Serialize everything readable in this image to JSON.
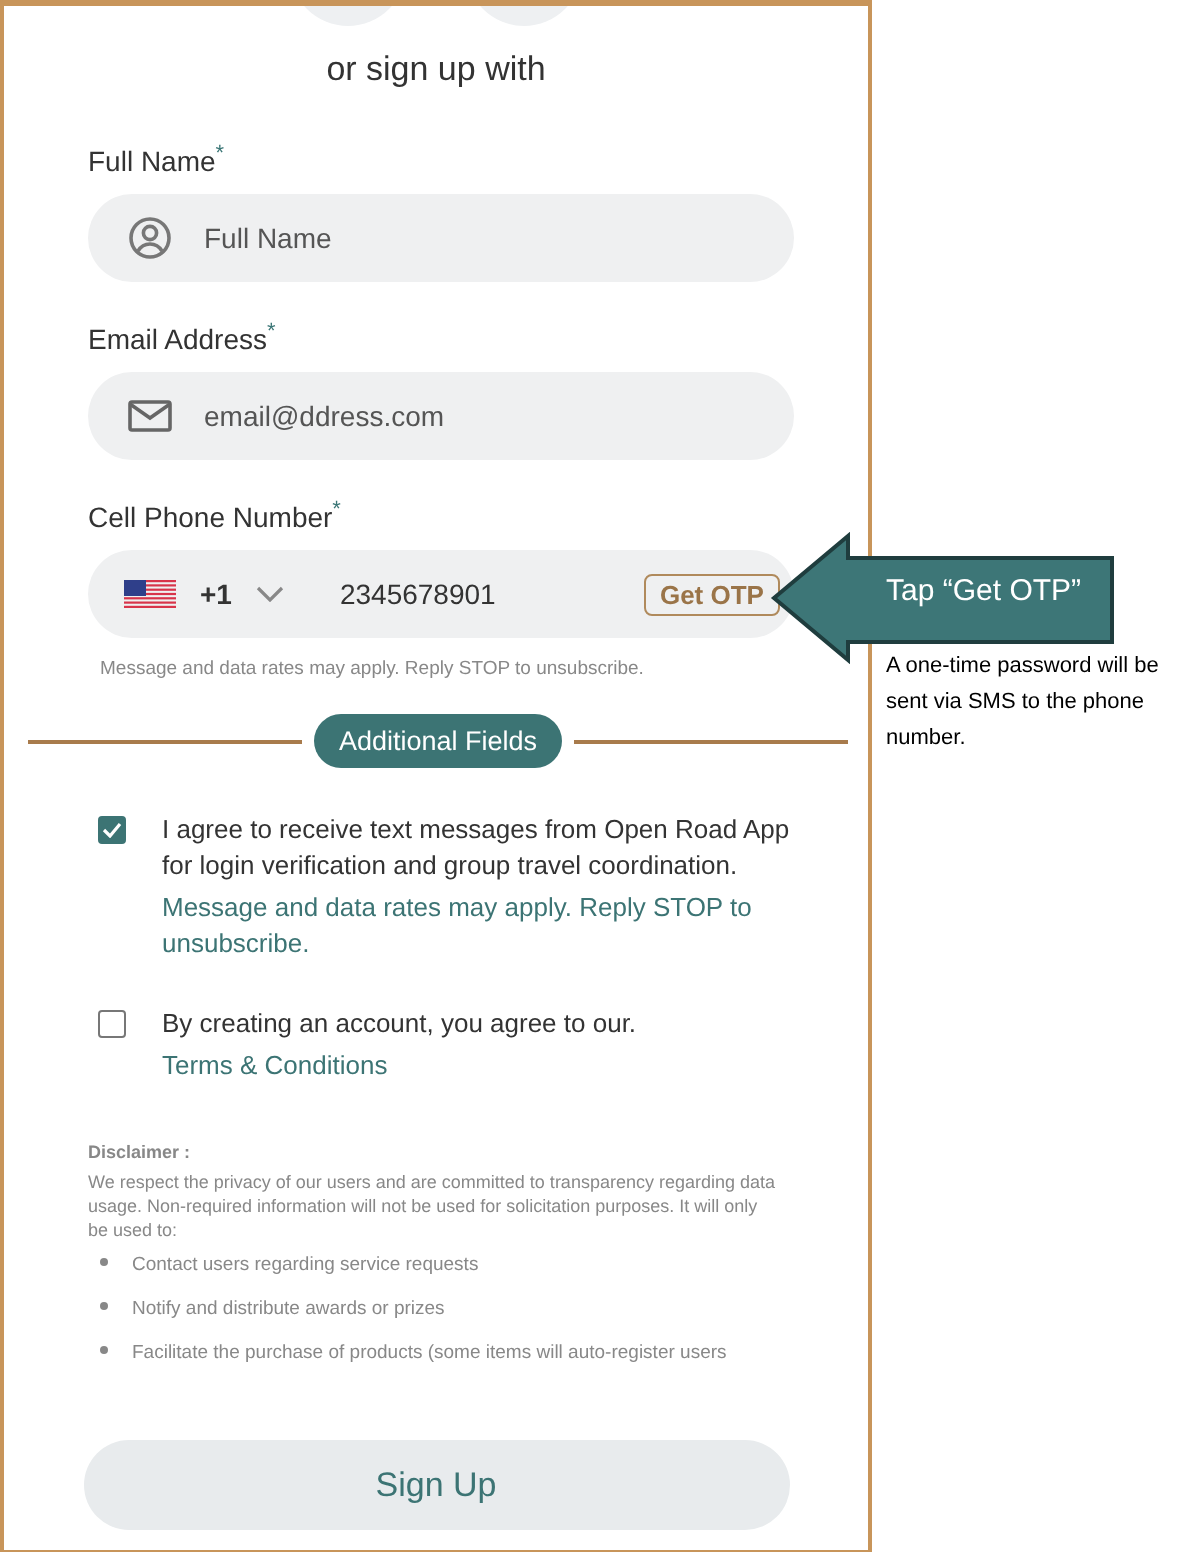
{
  "heading": "or sign up with",
  "fields": [
    {
      "kind": "name",
      "label": "Full Name",
      "required_mark": "*",
      "placeholder": "Full Name"
    },
    {
      "kind": "email",
      "label": "Email Address",
      "required_mark": "*",
      "placeholder": "email@ddress.com"
    },
    {
      "kind": "phone",
      "label": "Cell Phone Number",
      "required_mark": "*",
      "country_code": "+1",
      "value": "2345678901",
      "action": "Get OTP",
      "note": "Message and data rates may apply. Reply STOP to unsubscribe."
    }
  ],
  "section_divider": "Additional Fields",
  "consents": [
    {
      "checked": true,
      "text": "I agree to receive text messages from Open Road App for login verification and group travel coordination.",
      "link": "Message and data rates may apply. Reply STOP to unsubscribe."
    },
    {
      "checked": false,
      "text": "By creating an account, you agree to our.",
      "link": "Terms & Conditions"
    }
  ],
  "disclaimer": {
    "title": "Disclaimer :",
    "text": "We respect the privacy of our users and are committed to transparency regarding data usage. Non-required information will not be used for solicitation purposes. It will only be used to:",
    "items": [
      "Contact users regarding service requests",
      "Notify and distribute awards or prizes",
      "Facilitate the purchase of products (some items will auto-register users"
    ]
  },
  "submit": "Sign Up",
  "callout": {
    "label": "Tap “Get OTP”",
    "note": "A one-time password will be sent via SMS to the phone number."
  }
}
